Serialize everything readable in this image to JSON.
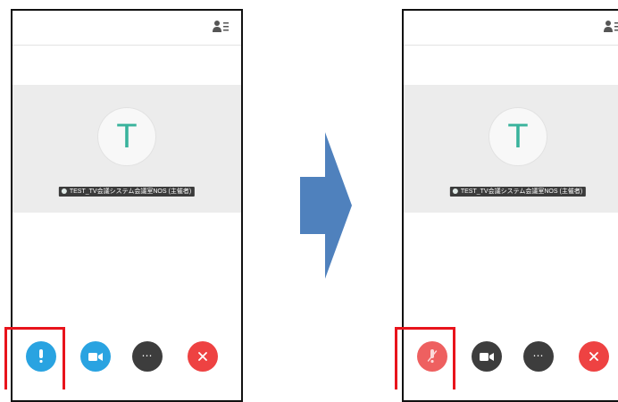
{
  "colors": {
    "avatar_letter": "#39b39c",
    "mic_active": "#29a3e1",
    "mic_muted": "#ee6060",
    "video_on": "#29a3e1",
    "video_off": "#3d3d3d",
    "more": "#3d3d3d",
    "hangup": "#ee4242",
    "highlight": "#e8141c",
    "arrow": "#4f81bd"
  },
  "before": {
    "avatar_letter": "T",
    "participant_name": "TEST_TV会議システム会議室NOS (主催者)",
    "icons": {
      "header": "participants-icon",
      "mic": "microphone-icon",
      "video": "video-camera-icon",
      "more": "more-icon",
      "hangup": "close-icon"
    },
    "more_glyph": "⋯"
  },
  "after": {
    "avatar_letter": "T",
    "participant_name": "TEST_TV会議システム会議室NOS (主催者)",
    "icons": {
      "header": "participants-icon",
      "mic": "microphone-muted-icon",
      "video": "video-camera-icon",
      "more": "more-icon",
      "hangup": "close-icon"
    },
    "more_glyph": "⋯"
  },
  "transition_arrow": "right-arrow-icon"
}
